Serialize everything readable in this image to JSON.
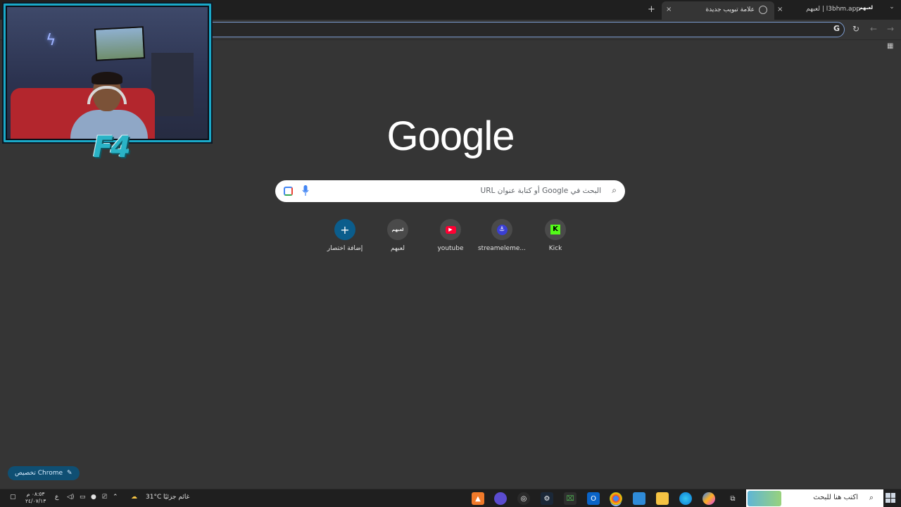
{
  "browser": {
    "tabs": [
      {
        "title": "علامة تبويب جديدة",
        "active": true
      },
      {
        "title": "لعبهم | l3bhm.app",
        "favicon_text": "لعبهم",
        "active": false
      }
    ],
    "new_tab_symbol": "+",
    "close_symbol": "×",
    "tablist_symbol": "⌄",
    "omnibox_g": "G"
  },
  "webcam": {
    "overlay_logo": "F4"
  },
  "page": {
    "logo_text": "Google",
    "search_placeholder": "البحث في Google أو كتابة عنوان URL",
    "shortcuts": [
      {
        "label": "إضافة اختصار",
        "icon": "+",
        "color": "#0b5d8c"
      },
      {
        "label": "لعبهم",
        "icon": "لعبهم",
        "color": "#4a4a4a"
      },
      {
        "label": "youtube",
        "icon": "▶",
        "color": "#ff0033"
      },
      {
        "label": "streameleme...",
        "icon": "⚓",
        "color": "#3a3fd4"
      },
      {
        "label": "Kick",
        "icon": "K",
        "color": "#53fc18"
      }
    ],
    "customize_label": "تخصيص Chrome",
    "customize_icon": "✎"
  },
  "taskbar": {
    "search_placeholder": "اكتب هنا للبحث",
    "weather_temp": "31°C",
    "weather_text": "غائم جزئيًا",
    "clock_time": "٠٨:٥٣ م",
    "clock_date": "٢٤/٠٧/١٣",
    "lang": "ع"
  }
}
